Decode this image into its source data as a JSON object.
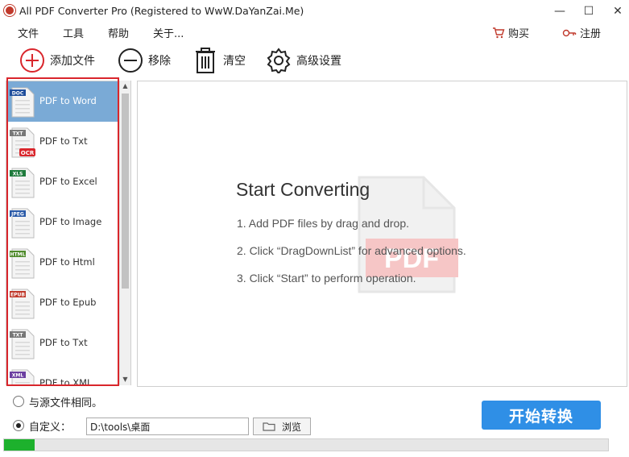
{
  "window": {
    "title": "All PDF Converter Pro (Registered to WwW.DaYanZai.Me)",
    "minimize": "—",
    "maximize": "☐",
    "close": "✕"
  },
  "menu": {
    "items": [
      "文件",
      "工具",
      "帮助",
      "关于..."
    ],
    "buy_label": "购买",
    "register_label": "注册"
  },
  "toolbar": {
    "add_label": "添加文件",
    "remove_label": "移除",
    "clear_label": "清空",
    "settings_label": "高级设置"
  },
  "conversions": [
    {
      "label": "PDF to Word",
      "tag": "DOC",
      "tag_color": "#1f4e9c",
      "selected": true
    },
    {
      "label": "PDF to Txt",
      "tag": "TXT",
      "tag_color": "#777777",
      "badge": "OCR",
      "selected": false
    },
    {
      "label": "PDF to Excel",
      "tag": "XLS",
      "tag_color": "#1e7b3c",
      "selected": false
    },
    {
      "label": "PDF to Image",
      "tag": "JPEG",
      "tag_color": "#2a5aa8",
      "selected": false
    },
    {
      "label": "PDF to Html",
      "tag": "HTML",
      "tag_color": "#4f8a2b",
      "selected": false
    },
    {
      "label": "PDF to Epub",
      "tag": "EPUB",
      "tag_color": "#c0392b",
      "selected": false
    },
    {
      "label": "PDF to Txt",
      "tag": "TXT",
      "tag_color": "#777777",
      "selected": false
    },
    {
      "label": "PDF to XML",
      "tag": "XML",
      "tag_color": "#6b3fa0",
      "selected": false
    }
  ],
  "main": {
    "title": "Start Converting",
    "steps": [
      "1. Add PDF files by drag and drop.",
      "2. Click “DragDownList” for advanced options.",
      "3. Click “Start” to perform operation."
    ],
    "watermark_text": "PDF"
  },
  "output": {
    "same_as_source_label": "与源文件相同。",
    "custom_label": "自定义：",
    "same_as_source_selected": false,
    "custom_selected": true,
    "path_value": "D:\\tools\\桌面",
    "browse_label": "浏览"
  },
  "start_button_label": "开始转换",
  "progress_percent": 5,
  "colors": {
    "accent_blue": "#2f8fe6",
    "selected_row": "#7aaad6",
    "highlight_frame": "#d9262c",
    "progress_green": "#1db12d"
  }
}
